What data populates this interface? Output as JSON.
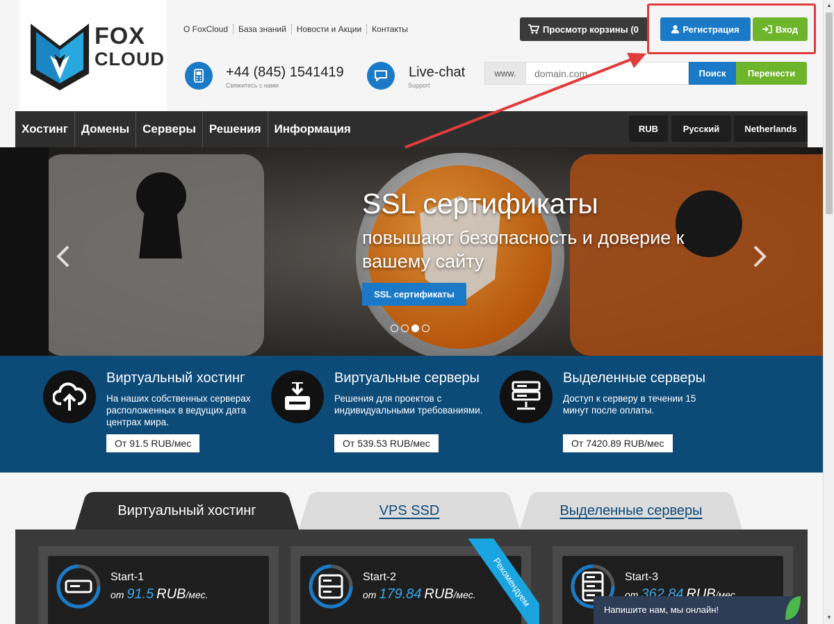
{
  "header": {
    "logo": {
      "line1": "FOX",
      "line2": "CLOUD"
    },
    "top_links": [
      "О FoxCloud",
      "База знаний",
      "Новости и Акции",
      "Контакты"
    ],
    "cart_label": "Просмотр корзины (0",
    "register_label": "Регистрация",
    "login_label": "Вход",
    "phone": {
      "number": "+44 (845) 1541419",
      "caption": "Свяжитесь с нами"
    },
    "chat": {
      "title": "Live-chat",
      "caption": "Support"
    },
    "domain": {
      "prefix": "www.",
      "placeholder": "domain.com",
      "search_label": "Поиск",
      "transfer_label": "Перенести"
    }
  },
  "nav": {
    "items": [
      "Хостинг",
      "Домены",
      "Серверы",
      "Решения",
      "Информация"
    ],
    "currency": "RUB",
    "language": "Русский",
    "region": "Netherlands"
  },
  "hero": {
    "title": "SSL сертификаты",
    "subtitle": "повышают безопасность и доверие к вашему сайту",
    "button_label": "SSL сертификаты",
    "slide_count": 4,
    "active_slide": 3
  },
  "features": [
    {
      "title": "Виртуальный хостинг",
      "desc": "На наших собственных серверах расположенных в ведущих дата центрах мира.",
      "price": "От 91.5 RUB/мес",
      "icon": "cloud-upload-icon"
    },
    {
      "title": "Виртуальные серверы",
      "desc": "Решения для проектов с индивидуальными требованиями.",
      "price": "От 539.53 RUB/мес",
      "icon": "server-download-icon"
    },
    {
      "title": "Выделенные серверы",
      "desc": "Доступ к серверу в течении 15 минут после оплаты.",
      "price": "От 7420.89 RUB/мес",
      "icon": "server-rack-icon"
    }
  ],
  "tabs": [
    "Виртуальный хостинг",
    "VPS SSD",
    "Выделенные серверы"
  ],
  "plans": [
    {
      "name": "Start-1",
      "prefix": "от",
      "price": "91.5",
      "currency": "RUB",
      "period": "/мес."
    },
    {
      "name": "Start-2",
      "prefix": "от",
      "price": "179.84",
      "currency": "RUB",
      "period": "/мес."
    },
    {
      "name": "Start-3",
      "prefix": "от",
      "price": "362.84",
      "currency": "RUB",
      "period": "/мес."
    }
  ],
  "ribbon_label": "Рекомендуем",
  "chat_widget": "Напишите нам, мы онлайн!",
  "colors": {
    "brand_blue": "#1a7ac8",
    "brand_green": "#6fb52c",
    "navy": "#0c4a78",
    "highlight_red": "#e03c3c"
  }
}
